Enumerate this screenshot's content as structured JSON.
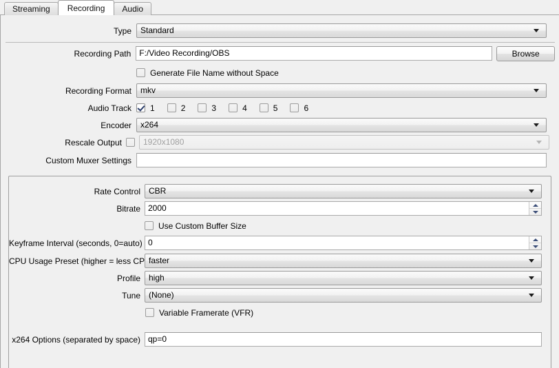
{
  "tabs": [
    {
      "label": "Streaming",
      "active": false
    },
    {
      "label": "Recording",
      "active": true
    },
    {
      "label": "Audio",
      "active": false
    }
  ],
  "top_section": {
    "type": {
      "label": "Type",
      "value": "Standard"
    },
    "recording_path": {
      "label": "Recording Path",
      "value": "F:/Video Recording/OBS",
      "browse_label": "Browse"
    },
    "generate_file_name": {
      "label": "Generate File Name without Space",
      "checked": false
    },
    "recording_format": {
      "label": "Recording Format",
      "value": "mkv"
    },
    "audio_track": {
      "label": "Audio Track",
      "tracks": [
        {
          "number": "1",
          "checked": true
        },
        {
          "number": "2",
          "checked": false
        },
        {
          "number": "3",
          "checked": false
        },
        {
          "number": "4",
          "checked": false
        },
        {
          "number": "5",
          "checked": false
        },
        {
          "number": "6",
          "checked": false
        }
      ]
    },
    "encoder": {
      "label": "Encoder",
      "value": "x264"
    },
    "rescale_output": {
      "label": "Rescale Output",
      "checked": false,
      "value": "1920x1080",
      "disabled": true
    },
    "custom_muxer": {
      "label": "Custom Muxer Settings",
      "value": ""
    }
  },
  "encoder_section": {
    "rate_control": {
      "label": "Rate Control",
      "value": "CBR"
    },
    "bitrate": {
      "label": "Bitrate",
      "value": "2000"
    },
    "use_custom_buffer": {
      "label": "Use Custom Buffer Size",
      "checked": false
    },
    "keyframe_interval": {
      "label": "Keyframe Interval (seconds, 0=auto)",
      "value": "0"
    },
    "cpu_preset": {
      "label": "CPU Usage Preset (higher = less CPU)",
      "value": "faster"
    },
    "profile": {
      "label": "Profile",
      "value": "high"
    },
    "tune": {
      "label": "Tune",
      "value": "(None)"
    },
    "variable_framerate": {
      "label": "Variable Framerate (VFR)",
      "checked": false
    },
    "x264_options": {
      "label": "x264 Options (separated by space)",
      "value": "qp=0"
    }
  }
}
